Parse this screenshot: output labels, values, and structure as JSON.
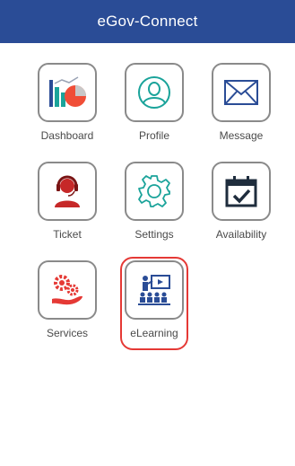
{
  "app": {
    "title": "eGov-Connect"
  },
  "colors": {
    "header": "#2a4c96",
    "accent_red": "#e53935",
    "icon_blue": "#2a4c96",
    "icon_teal": "#1aa39a"
  },
  "menu": [
    {
      "label": "Dashboard",
      "icon": "dashboard-chart-icon"
    },
    {
      "label": "Profile",
      "icon": "profile-user-icon"
    },
    {
      "label": "Message",
      "icon": "envelope-icon"
    },
    {
      "label": "Ticket",
      "icon": "support-agent-icon"
    },
    {
      "label": "Settings",
      "icon": "gear-icon"
    },
    {
      "label": "Availability",
      "icon": "calendar-check-icon"
    },
    {
      "label": "Services",
      "icon": "gears-hand-icon"
    },
    {
      "label": "eLearning",
      "icon": "presentation-class-icon"
    }
  ]
}
